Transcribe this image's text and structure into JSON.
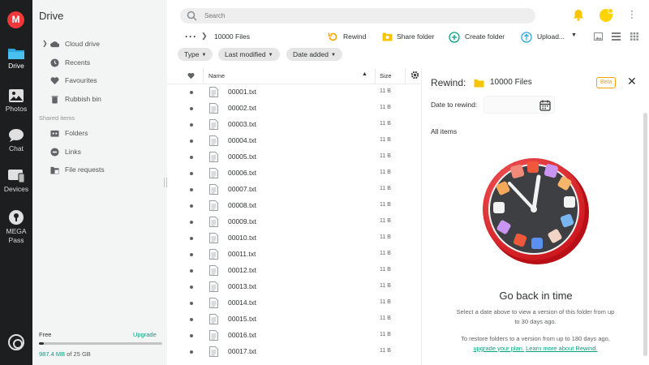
{
  "app": {
    "logo_letter": "M"
  },
  "rail": {
    "items": [
      {
        "label": "Drive",
        "icon": "drive-icon",
        "active": true
      },
      {
        "label": "Photos",
        "icon": "photos-icon"
      },
      {
        "label": "Chat",
        "icon": "chat-icon"
      },
      {
        "label": "Devices",
        "icon": "devices-icon"
      },
      {
        "label": "MEGA Pass",
        "icon": "pass-icon"
      }
    ]
  },
  "sidebar": {
    "title": "Drive",
    "items": [
      {
        "label": "Cloud drive",
        "icon": "cloud-icon"
      },
      {
        "label": "Recents",
        "icon": "clock-icon"
      },
      {
        "label": "Favourites",
        "icon": "heart-icon"
      },
      {
        "label": "Rubbish bin",
        "icon": "trash-icon"
      }
    ],
    "shared_label": "Shared items",
    "shared_items": [
      {
        "label": "Folders",
        "icon": "shared-folder-icon"
      },
      {
        "label": "Links",
        "icon": "link-icon"
      },
      {
        "label": "File requests",
        "icon": "file-request-icon"
      }
    ],
    "storage": {
      "plan": "Free",
      "upgrade": "Upgrade",
      "used": "987.4 MB",
      "total_text": "of 25 GB",
      "fraction": 0.039
    }
  },
  "search": {
    "placeholder": "Search"
  },
  "toolbar": {
    "path": "10000 Files",
    "rewind": "Rewind",
    "share_folder": "Share folder",
    "create_folder": "Create folder",
    "upload": "Upload..."
  },
  "filters": {
    "type": "Type",
    "last_modified": "Last modified",
    "date_added": "Date added"
  },
  "table": {
    "columns": {
      "name": "Name",
      "size": "Size"
    },
    "rows": [
      {
        "name": "00001.txt",
        "size": "11 B"
      },
      {
        "name": "00002.txt",
        "size": "11 B"
      },
      {
        "name": "00003.txt",
        "size": "11 B"
      },
      {
        "name": "00004.txt",
        "size": "11 B"
      },
      {
        "name": "00005.txt",
        "size": "11 B"
      },
      {
        "name": "00006.txt",
        "size": "11 B"
      },
      {
        "name": "00007.txt",
        "size": "11 B"
      },
      {
        "name": "00008.txt",
        "size": "11 B"
      },
      {
        "name": "00009.txt",
        "size": "11 B"
      },
      {
        "name": "00010.txt",
        "size": "11 B"
      },
      {
        "name": "00011.txt",
        "size": "11 B"
      },
      {
        "name": "00012.txt",
        "size": "11 B"
      },
      {
        "name": "00013.txt",
        "size": "11 B"
      },
      {
        "name": "00014.txt",
        "size": "11 B"
      },
      {
        "name": "00015.txt",
        "size": "11 B"
      },
      {
        "name": "00016.txt",
        "size": "11 B"
      },
      {
        "name": "00017.txt",
        "size": "11 B"
      }
    ]
  },
  "rewind_panel": {
    "title": "Rewind:",
    "folder": "10000 Files",
    "beta": "Beta",
    "date_label": "Date to rewind:",
    "all_items": "All items",
    "heading": "Go back in time",
    "desc": "Select a date above to view a version of this folder from up to 30 days ago.",
    "restore_text": "To restore folders to a version from up to 180 days ago,",
    "upgrade_link": "upgrade your plan.",
    "learn_link": "Learn more about Rewind."
  },
  "colors": {
    "accent": "#00a382",
    "brand": "#f0373a",
    "rail_bg": "#1d1e1f",
    "sidebar_bg": "#f3f4f4",
    "avatar": "#ffd300",
    "beta": "#f7a308"
  }
}
